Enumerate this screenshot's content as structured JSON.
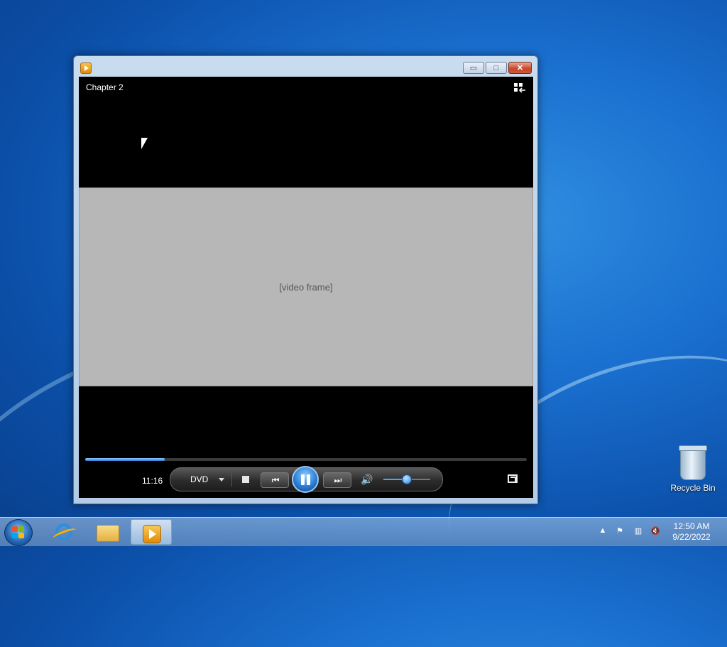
{
  "desktop": {
    "icons": [
      {
        "label": "Recycle Bin",
        "icon": "recycle-bin-icon"
      }
    ]
  },
  "window": {
    "app_icon": "windows-media-player-icon",
    "controls": {
      "minimize": "▭",
      "maximize": "□",
      "close": "✕"
    },
    "video": {
      "chapter": "Chapter 2",
      "switch_to_library_icon": "switch-to-library-icon",
      "frame_placeholder": "[video frame]"
    },
    "player": {
      "elapsed": "11:16",
      "seek_progress_fraction": 0.18,
      "source_menu": "DVD",
      "volume_fraction": 0.48,
      "buttons": {
        "stop": "stop-icon",
        "previous": "⏮",
        "play_pause": "pause-icon",
        "next": "⏭",
        "mute": "🔊",
        "fullscreen": "fullscreen-icon"
      }
    }
  },
  "taskbar": {
    "apps": [
      {
        "name": "Internet Explorer",
        "icon": "ie-icon",
        "active": false
      },
      {
        "name": "Windows Explorer",
        "icon": "folder-icon",
        "active": false
      },
      {
        "name": "Windows Media Player",
        "icon": "wmp-icon",
        "active": true
      }
    ],
    "tray": {
      "show_hidden": "▲",
      "flag": "⚑",
      "network": "▥",
      "volume_muted": "🔇"
    },
    "clock": {
      "time": "12:50 AM",
      "date": "9/22/2022"
    }
  },
  "colors": {
    "accent": "#2b7fd6",
    "close_button": "#c7452a",
    "desktop": "#1a6fcf"
  }
}
